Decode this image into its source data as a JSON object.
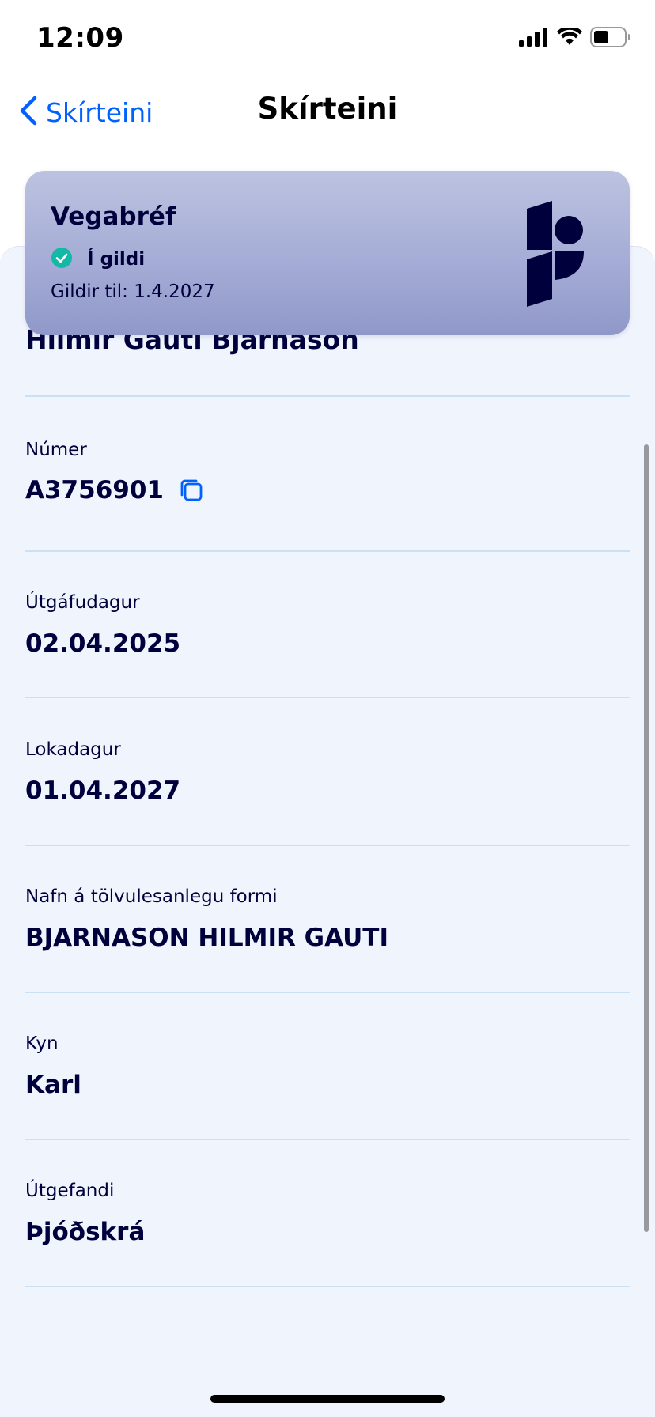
{
  "status_bar": {
    "time": "12:09"
  },
  "nav": {
    "back_label": "Skírteini",
    "title": "Skírteini"
  },
  "card": {
    "title": "Vegabréf",
    "status_label": "Í gildi",
    "valid_until": "Gildir til: 1.4.2027",
    "status_color": "#14b8a6"
  },
  "details": {
    "name": "Hilmir Gauti Bjarnason",
    "fields": [
      {
        "label": "Númer",
        "value": "A3756901"
      },
      {
        "label": "Útgáfudagur",
        "value": "02.04.2025"
      },
      {
        "label": "Lokadagur",
        "value": "01.04.2027"
      },
      {
        "label": "Nafn á tölvulesanlegu formi",
        "value": "BJARNASON HILMIR GAUTI"
      },
      {
        "label": "Kyn",
        "value": "Karl"
      },
      {
        "label": "Útgefandi",
        "value": "Þjóðskrá"
      }
    ]
  },
  "colors": {
    "accent": "#0061ff",
    "text_dark": "#00003c",
    "sheet_bg": "#f0f4fd",
    "divider": "#cce0f5"
  }
}
